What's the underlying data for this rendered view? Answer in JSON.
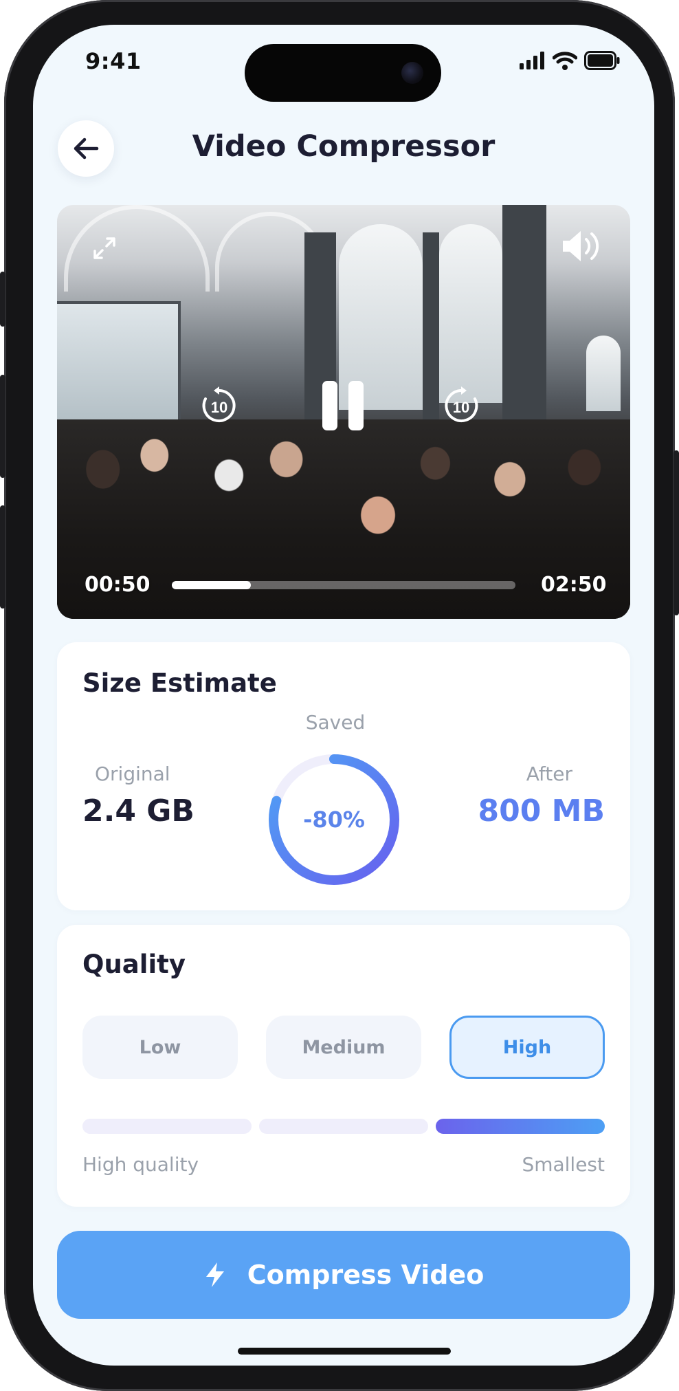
{
  "status_bar": {
    "time": "9:41"
  },
  "header": {
    "title": "Video Compressor",
    "back_icon": "arrow-left-icon"
  },
  "video": {
    "current_time": "00:50",
    "duration": "02:50",
    "progress": 0.23,
    "icons": [
      "expand-icon",
      "volume-icon",
      "rewind-10-icon",
      "pause-icon",
      "forward-10-icon"
    ],
    "rewind_label": "10",
    "forward_label": "10"
  },
  "size_estimate": {
    "title": "Size Estimate",
    "saved_label": "Saved",
    "saved_percent": "-80%",
    "saved_fraction": 0.8,
    "original_label": "Original",
    "original_value": "2.4 GB",
    "after_label": "After",
    "after_value": "800 MB"
  },
  "quality": {
    "title": "Quality",
    "options": [
      "Low",
      "Medium",
      "High"
    ],
    "selected": "High",
    "scale_left": "High quality",
    "scale_right": "Smallest"
  },
  "action": {
    "label": "Compress Video",
    "icon": "lightning-icon"
  },
  "colors": {
    "accent": "#5aa3f5",
    "accent_gradient_start": "#6b63ec",
    "accent_gradient_end": "#4d9ff4",
    "background": "#f1f8fd",
    "title_text": "#1d1e33"
  }
}
